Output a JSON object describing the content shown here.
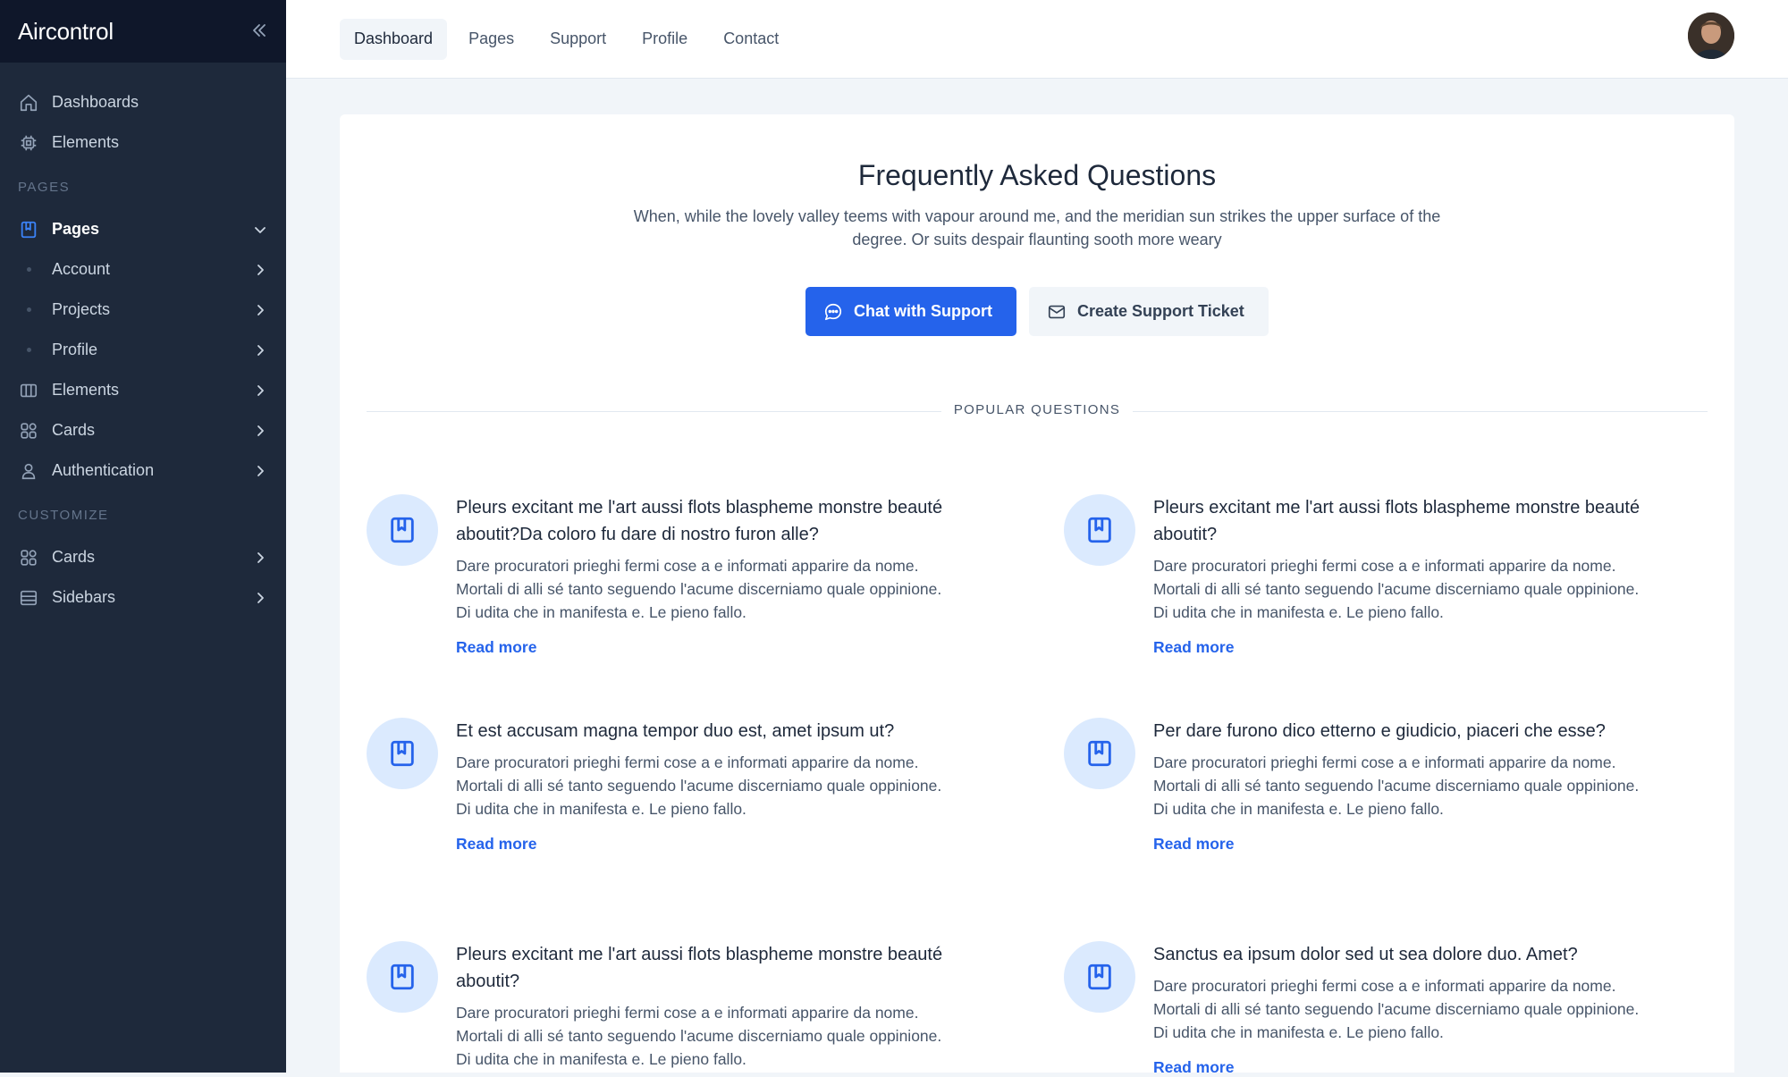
{
  "brand": {
    "name": "Aircontrol"
  },
  "sidebar": {
    "top_items": [
      {
        "label": "Dashboards"
      },
      {
        "label": "Elements"
      }
    ],
    "section_pages": "PAGES",
    "pages_item": {
      "label": "Pages"
    },
    "sub_items": [
      {
        "label": "Account"
      },
      {
        "label": "Projects"
      },
      {
        "label": "Profile"
      }
    ],
    "page_items": [
      {
        "label": "Elements"
      },
      {
        "label": "Cards"
      },
      {
        "label": "Authentication"
      }
    ],
    "section_customize": "CUSTOMIZE",
    "customize_items": [
      {
        "label": "Cards"
      },
      {
        "label": "Sidebars"
      }
    ]
  },
  "topnav": {
    "tabs": [
      {
        "label": "Dashboard"
      },
      {
        "label": "Pages"
      },
      {
        "label": "Support"
      },
      {
        "label": "Profile"
      },
      {
        "label": "Contact"
      }
    ]
  },
  "faq": {
    "title": "Frequently Asked Questions",
    "subtitle": "When, while the lovely valley teems with vapour around me, and the meridian sun strikes the upper surface of the degree. Or suits despair flaunting sooth more weary",
    "chat_button": "Chat with Support",
    "ticket_button": "Create Support Ticket",
    "divider_label": "POPULAR QUESTIONS",
    "read_more": "Read more",
    "questions": [
      {
        "title": "Pleurs excitant me l'art aussi flots blaspheme monstre beauté aboutit?Da coloro fu dare di nostro furon alle?",
        "text": "Dare procuratori prieghi fermi cose a e informati apparire da nome. Mortali di alli sé tanto seguendo l'acume discerniamo quale oppinione. Di udita che in manifesta e. Le pieno fallo."
      },
      {
        "title": "Pleurs excitant me l'art aussi flots blaspheme monstre beauté aboutit?",
        "text": "Dare procuratori prieghi fermi cose a e informati apparire da nome. Mortali di alli sé tanto seguendo l'acume discerniamo quale oppinione. Di udita che in manifesta e. Le pieno fallo."
      },
      {
        "title": "Et est accusam magna tempor duo est, amet ipsum ut?",
        "text": "Dare procuratori prieghi fermi cose a e informati apparire da nome. Mortali di alli sé tanto seguendo l'acume discerniamo quale oppinione. Di udita che in manifesta e. Le pieno fallo."
      },
      {
        "title": "Per dare furono dico etterno e giudicio, piaceri che esse?",
        "text": "Dare procuratori prieghi fermi cose a e informati apparire da nome. Mortali di alli sé tanto seguendo l'acume discerniamo quale oppinione. Di udita che in manifesta e. Le pieno fallo."
      },
      {
        "title": "Pleurs excitant me l'art aussi flots blaspheme monstre beauté aboutit?",
        "text": "Dare procuratori prieghi fermi cose a e informati apparire da nome. Mortali di alli sé tanto seguendo l'acume discerniamo quale oppinione. Di udita che in manifesta e. Le pieno fallo."
      },
      {
        "title": "Sanctus ea ipsum dolor sed ut sea dolore duo. Amet?",
        "text": "Dare procuratori prieghi fermi cose a e informati apparire da nome. Mortali di alli sé tanto seguendo l'acume discerniamo quale oppinione. Di udita che in manifesta e. Le pieno fallo."
      }
    ]
  },
  "colors": {
    "accent": "#2563eb",
    "sidebar_bg": "#1e293b",
    "brand_bg": "#0f172a"
  }
}
